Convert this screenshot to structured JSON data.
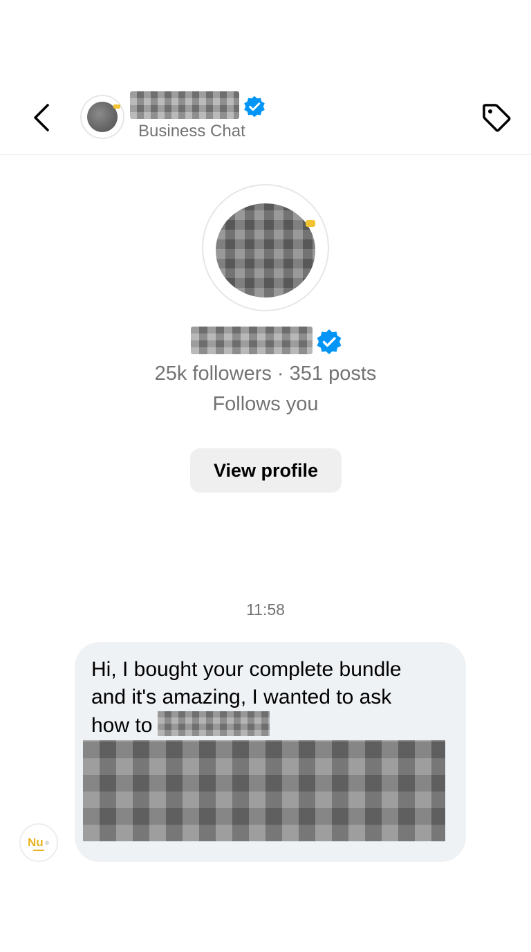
{
  "header": {
    "back_icon": "chevron-left-icon",
    "subtitle": "Business Chat",
    "verified_icon": "verified-badge-icon",
    "tag_icon": "tag-icon"
  },
  "profile": {
    "stats": "25k followers · 351 posts",
    "follows_status": "Follows you",
    "view_profile_label": "View profile"
  },
  "conversation": {
    "timestamp": "11:58",
    "message": {
      "line1": "Hi, I bought your complete bundle",
      "line2": "and it's amazing, I wanted to ask",
      "line3_prefix": "how to",
      "sender_avatar_text": "Nu"
    }
  },
  "colors": {
    "verified_blue": "#0095f6",
    "bubble_bg": "#eff2f5",
    "button_bg": "#efefef",
    "secondary_text": "#737373",
    "avatar_crown": "#f2c230"
  }
}
